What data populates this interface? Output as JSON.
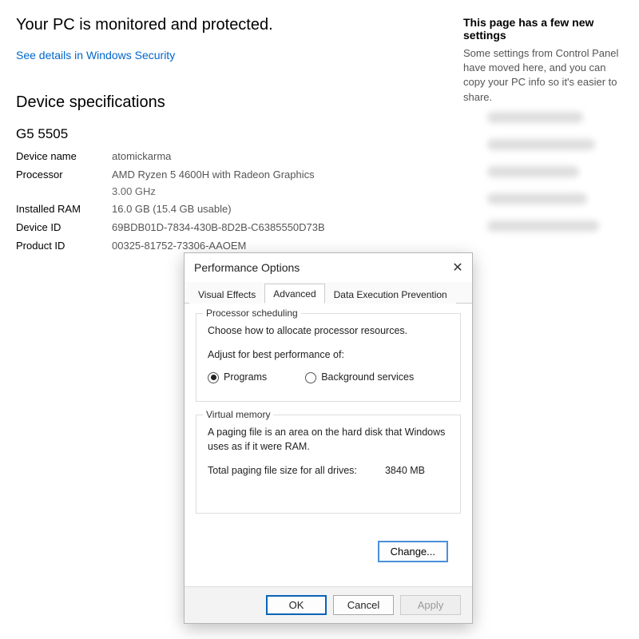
{
  "status": {
    "heading": "Your PC is monitored and protected.",
    "link": "See details in Windows Security"
  },
  "specs": {
    "heading": "Device specifications",
    "model": "G5 5505",
    "rows": {
      "device_name": {
        "label": "Device name",
        "value": "atomickarma"
      },
      "processor": {
        "label": "Processor",
        "value": "AMD Ryzen 5 4600H with Radeon Graphics",
        "value2": "3.00 GHz"
      },
      "installed_ram": {
        "label": "Installed RAM",
        "value": "16.0 GB (15.4 GB usable)"
      },
      "device_id": {
        "label": "Device ID",
        "value": "69BDB01D-7834-430B-8D2B-C6385550D73B"
      },
      "product_id": {
        "label": "Product ID",
        "value": "00325-81752-73306-AAOEM"
      }
    }
  },
  "right": {
    "heading": "This page has a few new settings",
    "text": "Some settings from Control Panel have moved here, and you can copy your PC info so it's easier to share."
  },
  "dialog": {
    "title": "Performance Options",
    "tabs": {
      "visual": "Visual Effects",
      "advanced": "Advanced",
      "dep": "Data Execution Prevention"
    },
    "proc": {
      "legend": "Processor scheduling",
      "desc": "Choose how to allocate processor resources.",
      "subhead": "Adjust for best performance of:",
      "opt_programs": "Programs",
      "opt_bg": "Background services"
    },
    "vm": {
      "legend": "Virtual memory",
      "desc": "A paging file is an area on the hard disk that Windows uses as if it were RAM.",
      "total_label": "Total paging file size for all drives:",
      "total_value": "3840 MB",
      "change": "Change..."
    },
    "buttons": {
      "ok": "OK",
      "cancel": "Cancel",
      "apply": "Apply"
    }
  }
}
